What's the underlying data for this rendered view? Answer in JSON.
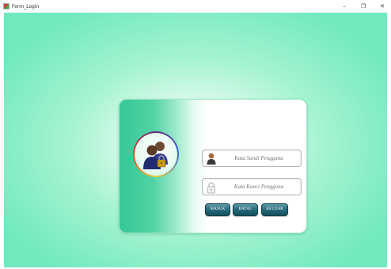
{
  "window": {
    "title": "Form_Login",
    "controls": {
      "minimize": "–",
      "maximize": "❐",
      "close": "✕"
    }
  },
  "login": {
    "username_placeholder": "Kata Sandi Pengguna",
    "password_placeholder": "Kata Kunci Pengguna",
    "buttons": {
      "masuk": "MASUK",
      "batal": "BATAL",
      "keluar": "KELUAR"
    }
  },
  "icons": {
    "app": "form-app-icon",
    "avatar": "users-lock-icon",
    "username_field": "user-icon",
    "password_field": "padlock-icon"
  },
  "colors": {
    "background_accent": "#6fe9bd",
    "card_gradient_start": "#34c795",
    "button": "#2a6d7d"
  }
}
